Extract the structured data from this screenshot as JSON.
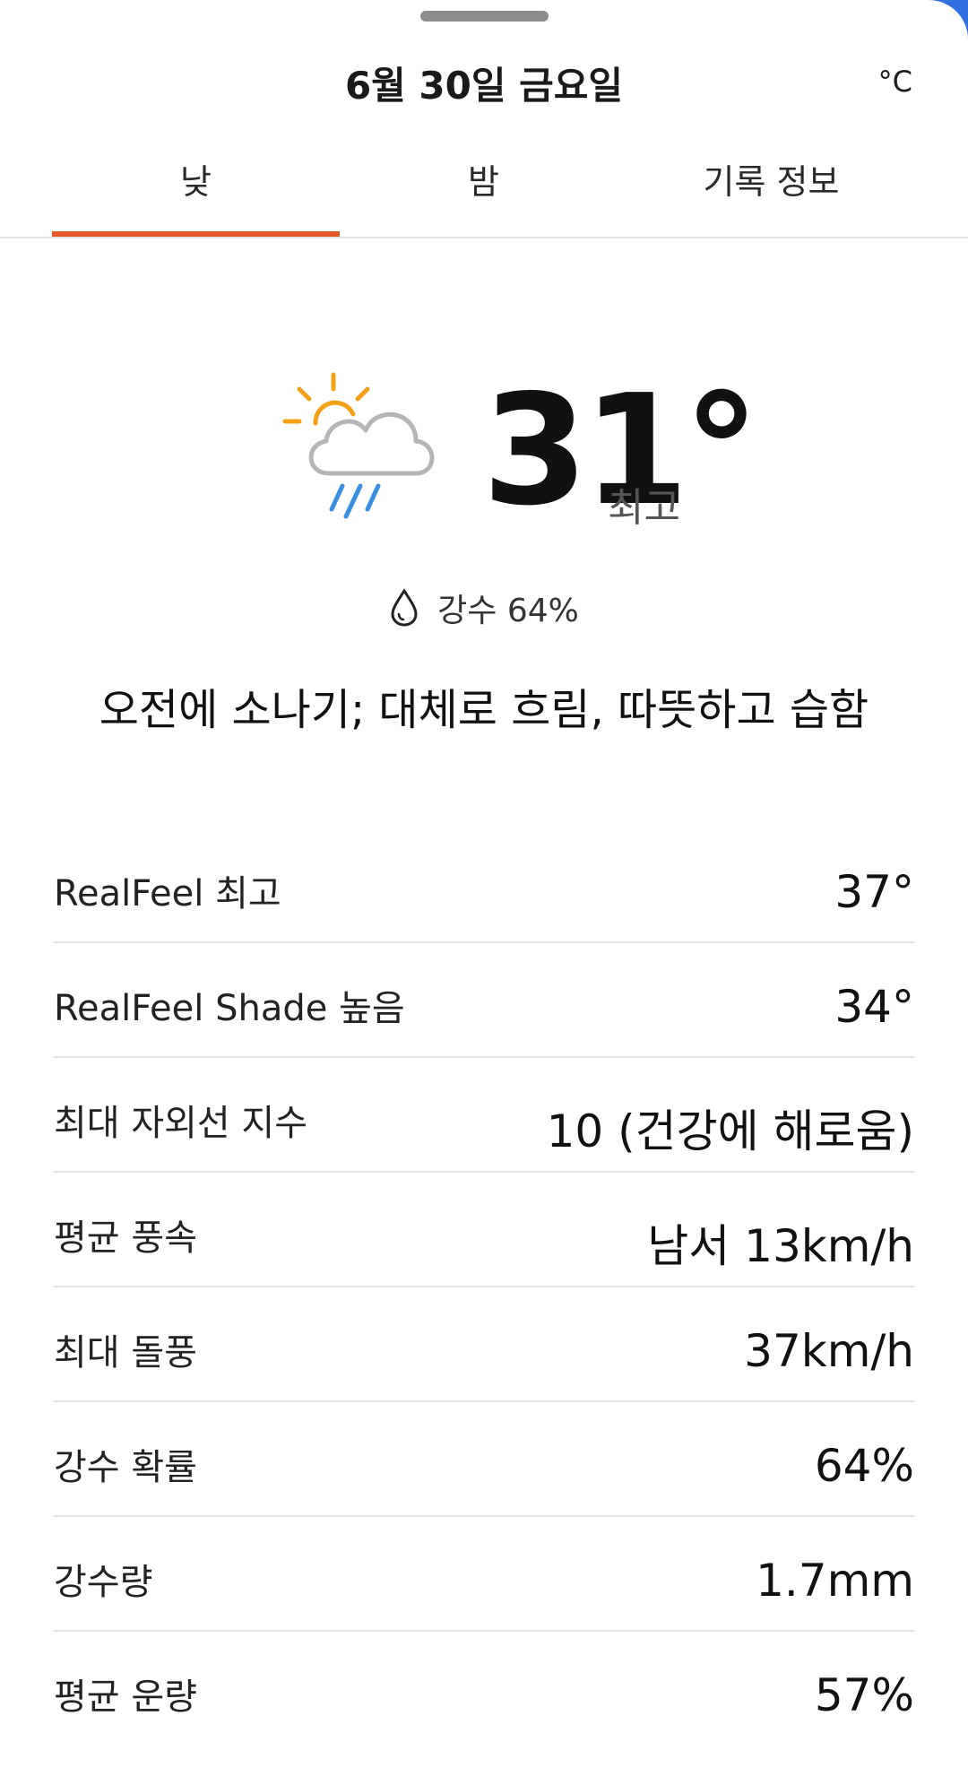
{
  "header": {
    "title": "6월 30일 금요일",
    "unit": "°C"
  },
  "tabs": [
    {
      "label": "낮",
      "active": true
    },
    {
      "label": "밤",
      "active": false
    },
    {
      "label": "기록 정보",
      "active": false
    }
  ],
  "colors": {
    "accent": "#e5582a",
    "sun": "#f4a11a",
    "rain": "#3b8fe0",
    "cloud": "#b5b5b5"
  },
  "forecast": {
    "icon": "partly-sunny-showers-icon",
    "temperature": "31°",
    "temperature_label": "최고",
    "precip_icon": "raindrop-icon",
    "precip_text": "강수 64%",
    "phrase": "오전에 소나기; 대체로 흐림, 따뜻하고 습함"
  },
  "details": [
    {
      "label": "RealFeel 최고",
      "value": "37°"
    },
    {
      "label": "RealFeel Shade 높음",
      "value": "34°"
    },
    {
      "label": "최대 자외선 지수",
      "value": "10 (건강에 해로움)"
    },
    {
      "label": "평균 풍속",
      "value": "남서 13km/h"
    },
    {
      "label": "최대 돌풍",
      "value": "37km/h"
    },
    {
      "label": "강수 확률",
      "value": "64%"
    },
    {
      "label": "강수량",
      "value": "1.7mm"
    },
    {
      "label": "평균 운량",
      "value": "57%"
    }
  ]
}
